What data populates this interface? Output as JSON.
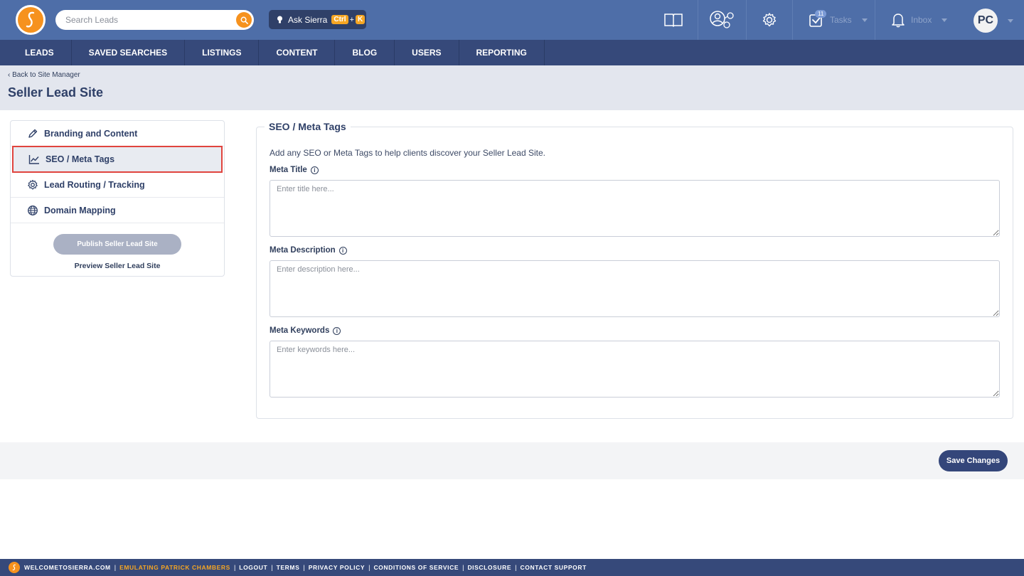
{
  "header": {
    "search_placeholder": "Search Leads",
    "ask_label": "Ask Sierra",
    "kbd_ctrl": "Ctrl",
    "kbd_plus": "+",
    "kbd_k": "K",
    "tasks_label": "Tasks",
    "tasks_badge": "11",
    "inbox_label": "Inbox",
    "avatar_initials": "PC"
  },
  "nav": {
    "items": [
      "LEADS",
      "SAVED SEARCHES",
      "LISTINGS",
      "CONTENT",
      "BLOG",
      "USERS",
      "REPORTING"
    ]
  },
  "page": {
    "back_link": "‹ Back to Site Manager",
    "title": "Seller Lead Site"
  },
  "sidebar": {
    "items": [
      {
        "label": "Branding and Content"
      },
      {
        "label": "SEO / Meta Tags"
      },
      {
        "label": "Lead Routing / Tracking"
      },
      {
        "label": "Domain Mapping"
      }
    ],
    "publish_label": "Publish Seller Lead Site",
    "preview_label": "Preview Seller Lead Site"
  },
  "form": {
    "legend": "SEO / Meta Tags",
    "help_text": "Add any SEO or Meta Tags to help clients discover your Seller Lead Site.",
    "meta_title_label": "Meta Title",
    "meta_title_placeholder": "Enter title here...",
    "meta_description_label": "Meta Description",
    "meta_description_placeholder": "Enter description here...",
    "meta_keywords_label": "Meta Keywords",
    "meta_keywords_placeholder": "Enter keywords here...",
    "info_glyph": "i",
    "save_label": "Save Changes"
  },
  "footer": {
    "site": "WELCOMETOSIERRA.COM",
    "emulating": "EMULATING PATRICK CHAMBERS",
    "logout": "LOGOUT",
    "terms": "TERMS",
    "privacy": "PRIVACY POLICY",
    "conditions": "CONDITIONS OF SERVICE",
    "disclosure": "DISCLOSURE",
    "support": "CONTACT SUPPORT",
    "separator": "|"
  },
  "colors": {
    "topbar": "#4e6ea8",
    "nav": "#36497a",
    "accent_orange": "#f6921e",
    "active_outline": "#e0443e"
  }
}
